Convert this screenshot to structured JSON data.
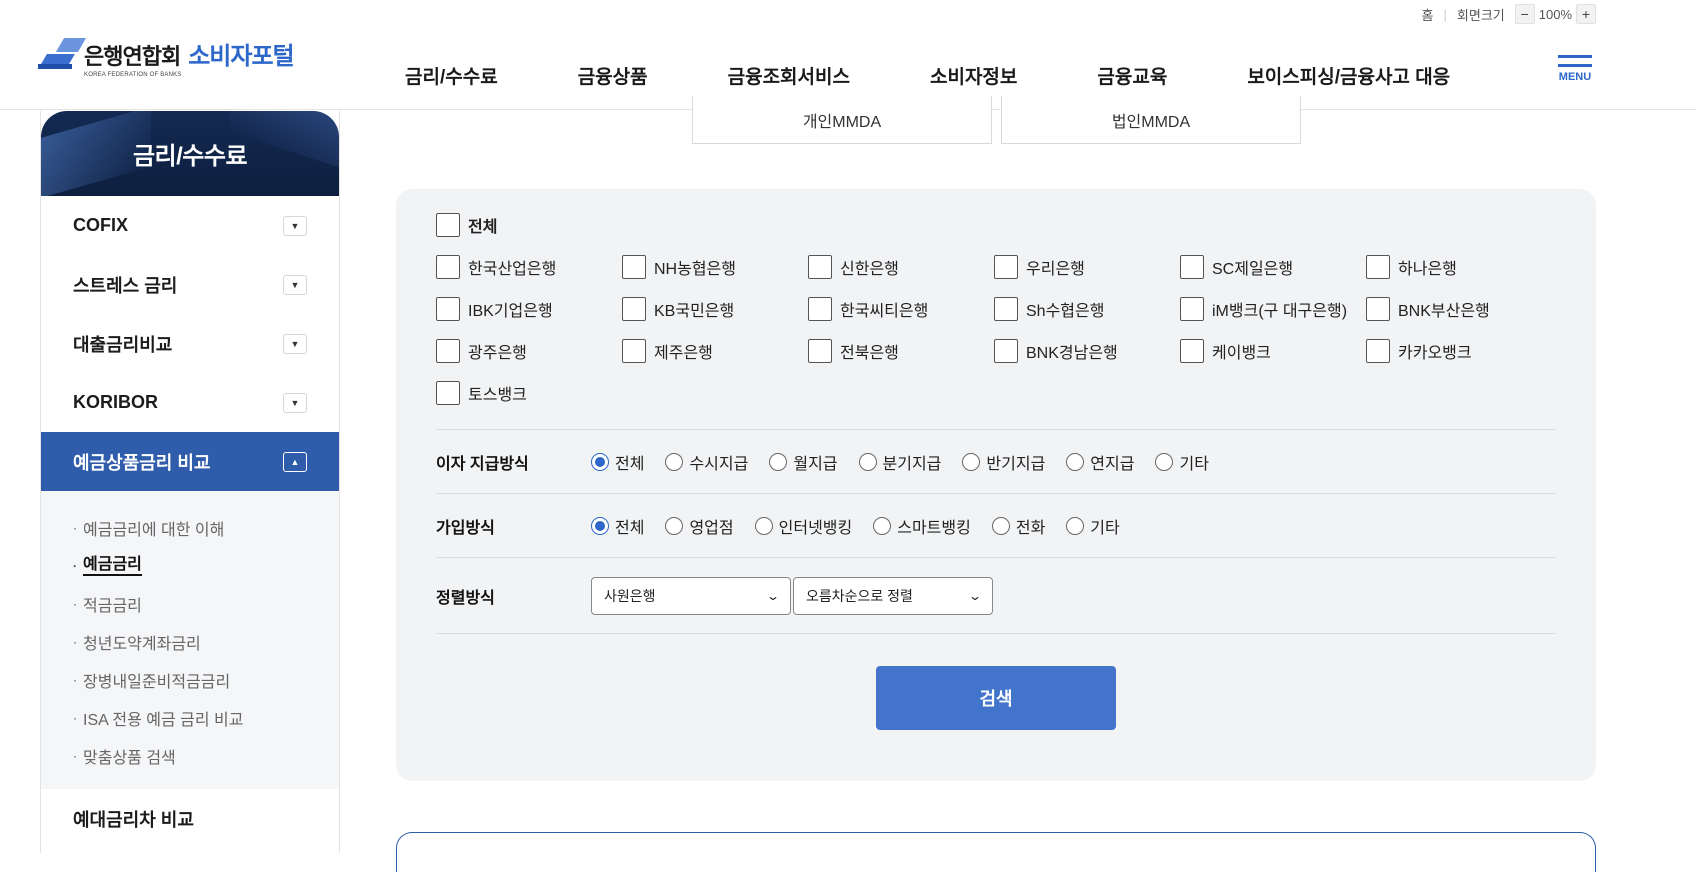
{
  "utility": {
    "home": "홈",
    "zoom_label": "회면크기",
    "zoom_minus": "−",
    "zoom_value": "100%",
    "zoom_plus": "+"
  },
  "logo": {
    "org": "은행연합회",
    "portal": "소비자포털",
    "sub": "KOREA FEDERATION OF BANKS"
  },
  "nav": [
    "금리/수수료",
    "금융상품",
    "금융조회서비스",
    "소비자정보",
    "금융교육",
    "보이스피싱/금융사고 대응"
  ],
  "menu_label": "MENU",
  "sidebar": {
    "title": "금리/수수료",
    "items": [
      {
        "label": "COFIX"
      },
      {
        "label": "스트레스 금리"
      },
      {
        "label": "대출금리비교"
      },
      {
        "label": "KORIBOR"
      },
      {
        "label": "예금상품금리 비교"
      }
    ],
    "sub_items": [
      {
        "label": "예금금리에 대한 이해"
      },
      {
        "label": "예금금리"
      },
      {
        "label": "적금금리"
      },
      {
        "label": "청년도약계좌금리"
      },
      {
        "label": "장병내일준비적금금리"
      },
      {
        "label": "ISA 전용 예금 금리 비교"
      },
      {
        "label": "맞춤상품 검색"
      }
    ],
    "last_item": "예대금리차 비교",
    "bullet": "·"
  },
  "tabs": [
    "개인MMDA",
    "법인MMDA"
  ],
  "filter": {
    "all_label": "전체",
    "banks": [
      "한국산업은행",
      "NH농협은행",
      "신한은행",
      "우리은행",
      "SC제일은행",
      "하나은행",
      "IBK기업은행",
      "KB국민은행",
      "한국씨티은행",
      "Sh수협은행",
      "iM뱅크(구 대구은행)",
      "BNK부산은행",
      "광주은행",
      "제주은행",
      "전북은행",
      "BNK경남은행",
      "케이뱅크",
      "카카오뱅크",
      "토스뱅크"
    ],
    "interest": {
      "label": "이자 지급방식",
      "options": [
        "전체",
        "수시지급",
        "월지급",
        "분기지급",
        "반기지급",
        "연지급",
        "기타"
      ],
      "selected": "전체"
    },
    "join": {
      "label": "가입방식",
      "options": [
        "전체",
        "영업점",
        "인터넷뱅킹",
        "스마트뱅킹",
        "전화",
        "기타"
      ],
      "selected": "전체"
    },
    "sort": {
      "label": "정렬방식",
      "select1": "사원은행",
      "select2": "오름차순으로 정렬"
    },
    "search_label": "검색"
  }
}
